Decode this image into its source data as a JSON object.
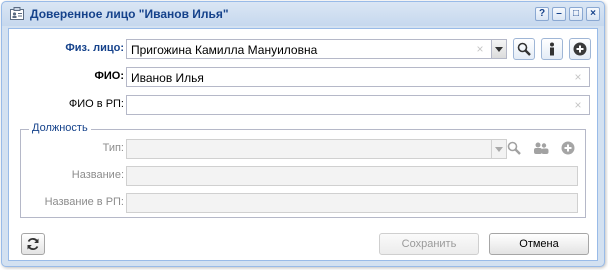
{
  "window": {
    "title": "Доверенное лицо \"Иванов Илья\"",
    "tools": [
      "?",
      "–",
      "□",
      "×"
    ]
  },
  "form": {
    "person": {
      "label": "Физ. лицо:",
      "value": "Пригожина Камилла Мануиловна"
    },
    "fio": {
      "label": "ФИО:",
      "value": "Иванов Илья"
    },
    "fio_rp": {
      "label": "ФИО в РП:",
      "value": ""
    }
  },
  "position": {
    "legend": "Должность",
    "type_label": "Тип:",
    "name_label": "Название:",
    "name_rp_label": "Название в РП:"
  },
  "footer": {
    "save_label": "Сохранить",
    "cancel_label": "Отмена"
  }
}
